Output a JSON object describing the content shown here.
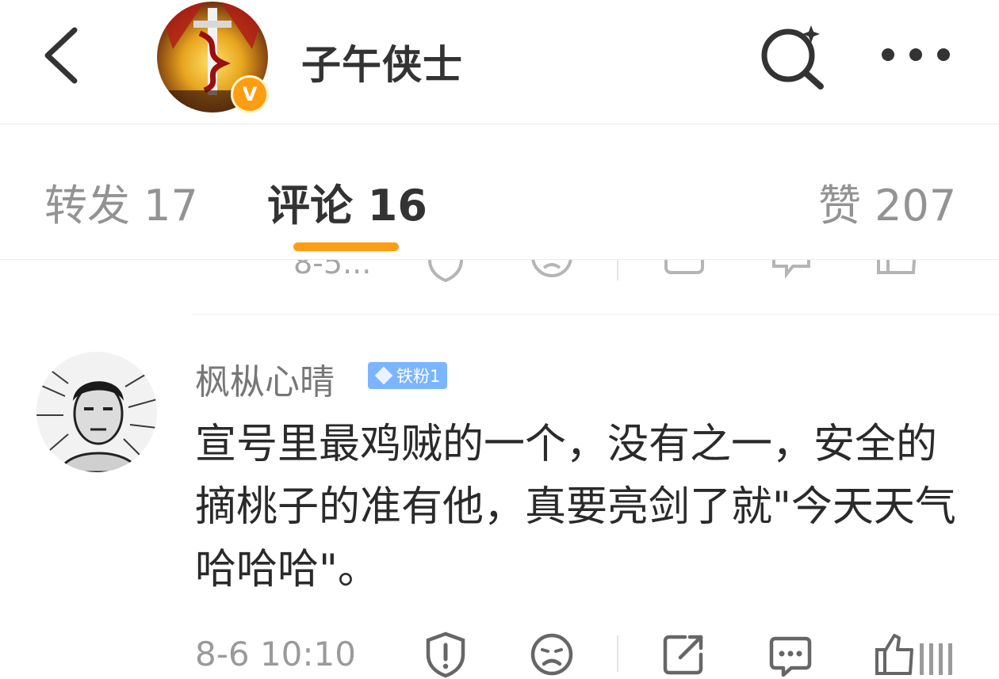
{
  "header": {
    "title": "子午侠士",
    "verified_badge": "V",
    "icons": [
      "back-arrow-icon",
      "search-sparkle-icon",
      "more-dots-icon"
    ]
  },
  "tabs": [
    {
      "label": "转发 17",
      "active": false
    },
    {
      "label": "评论 16",
      "active": true
    },
    {
      "label": "赞 207",
      "active": false
    }
  ],
  "accent_color": "#ff9d12",
  "previous_comment": {
    "time": "8-5..."
  },
  "comment": {
    "username": "枫枞心晴",
    "badge": "铁粉1",
    "text": "宣号里最鸡贼的一个，没有之一，安全的摘桃子的准有他，真要亮剑了就\"今天天气哈哈哈\"。",
    "time": "8-6 10:10",
    "actions": [
      "report-icon",
      "dislike-icon",
      "share-icon",
      "reply-icon",
      "like-icon"
    ]
  }
}
